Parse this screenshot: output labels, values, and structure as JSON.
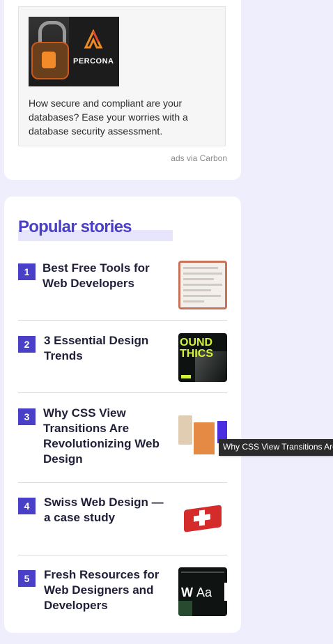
{
  "ad": {
    "brand_text": "PERCONA",
    "body": "How secure and compliant are your databases? Ease your worries with a database security assessment.",
    "via": "ads via Carbon"
  },
  "popular": {
    "title": "Popular stories",
    "stories": [
      {
        "number": "1",
        "title": "Best Free Tools for Web Developers"
      },
      {
        "number": "2",
        "title": "3 Essential Design Trends"
      },
      {
        "number": "3",
        "title": "Why CSS View Transitions Are Revolutionizing Web Design"
      },
      {
        "number": "4",
        "title": "Swiss Web Design — a case study"
      },
      {
        "number": "5",
        "title": "Fresh Resources for Web Designers and Developers"
      }
    ],
    "thumb2_text": [
      "OUND",
      "THICS"
    ],
    "thumb5_text": [
      "W",
      "Aa"
    ]
  },
  "tooltip": {
    "text": "Why CSS View Transitions Are"
  },
  "colors": {
    "accent": "#4a3fc7",
    "page_bg": "#efeefc",
    "title_highlight": "#e7e5fb",
    "text_dark": "#1f1f3a"
  }
}
